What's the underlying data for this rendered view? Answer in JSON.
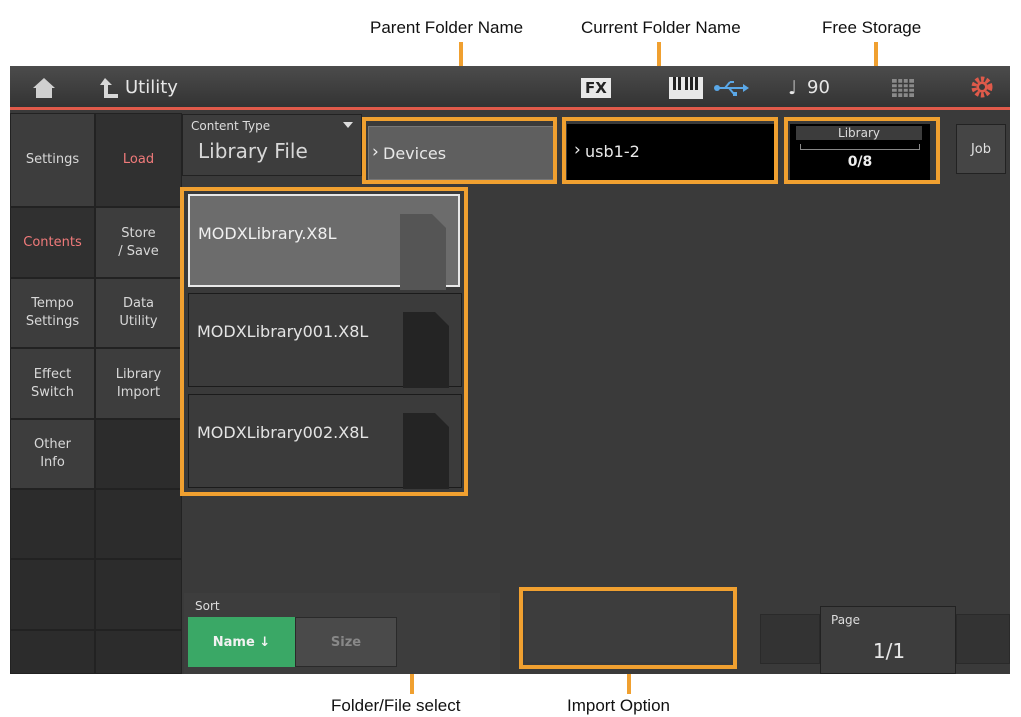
{
  "annotations": {
    "parent_folder_name": "Parent Folder Name",
    "current_folder_name": "Current Folder Name",
    "free_storage": "Free Storage",
    "folder_file_select": "Folder/File select",
    "import_option": "Import Option"
  },
  "topbar": {
    "title": "Utility",
    "fx_label": "FX",
    "tempo": "90",
    "tempo_symbol": "♩",
    "colors": {
      "accent": "#e05a4a",
      "usb": "#5aa8e8"
    }
  },
  "left_tabs": [
    "Settings",
    "Contents",
    "Tempo\nSettings",
    "Effect\nSwitch",
    "Other\nInfo"
  ],
  "sub_tabs": [
    "Load",
    "Store\n/ Save",
    "Data\nUtility",
    "Library\nImport"
  ],
  "content_type": {
    "label": "Content Type",
    "value": "Library File"
  },
  "parent_folder": "Devices",
  "current_folder": "usb1-2",
  "free_storage": {
    "label": "Library",
    "value": "0/8"
  },
  "job_label": "Job",
  "files": [
    {
      "name": "MODXLibrary.X8L",
      "selected": true
    },
    {
      "name": "MODXLibrary001.X8L",
      "selected": false
    },
    {
      "name": "MODXLibrary002.X8L",
      "selected": false
    }
  ],
  "sort": {
    "label": "Sort",
    "name_option": "Name ↓",
    "size_option": "Size"
  },
  "page": {
    "label": "Page",
    "value": "1/1"
  }
}
